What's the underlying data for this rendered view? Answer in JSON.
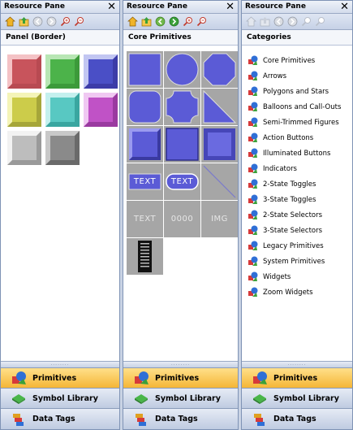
{
  "panes": [
    {
      "title": "Resource Pane",
      "header": "Panel (Border)"
    },
    {
      "title": "Resource Pane",
      "header": "Core Primitives"
    },
    {
      "title": "Resource Pane",
      "header": "Categories"
    }
  ],
  "close_glyph": "✕",
  "primitives": {
    "text1": "TEXT",
    "text2": "TEXT",
    "text3": "TEXT",
    "num": "0000",
    "img": "IMG"
  },
  "categories": [
    "Core Primitives",
    "Arrows",
    "Polygons and Stars",
    "Balloons and Call-Outs",
    "Semi-Trimmed Figures",
    "Action Buttons",
    "Illuminated Buttons",
    "Indicators",
    "2-State Toggles",
    "3-State Toggles",
    "2-State Selectors",
    "3-State Selectors",
    "Legacy Primitives",
    "System Primitives",
    "Widgets",
    "Zoom Widgets"
  ],
  "nav": {
    "primitives": "Primitives",
    "symbol_library": "Symbol Library",
    "data_tags": "Data Tags"
  },
  "grip": "........",
  "colors": {
    "accent_nav": "#f5b636",
    "primitive_blue": "#5b5bd6",
    "cell_gray": "#a6a6a6"
  }
}
